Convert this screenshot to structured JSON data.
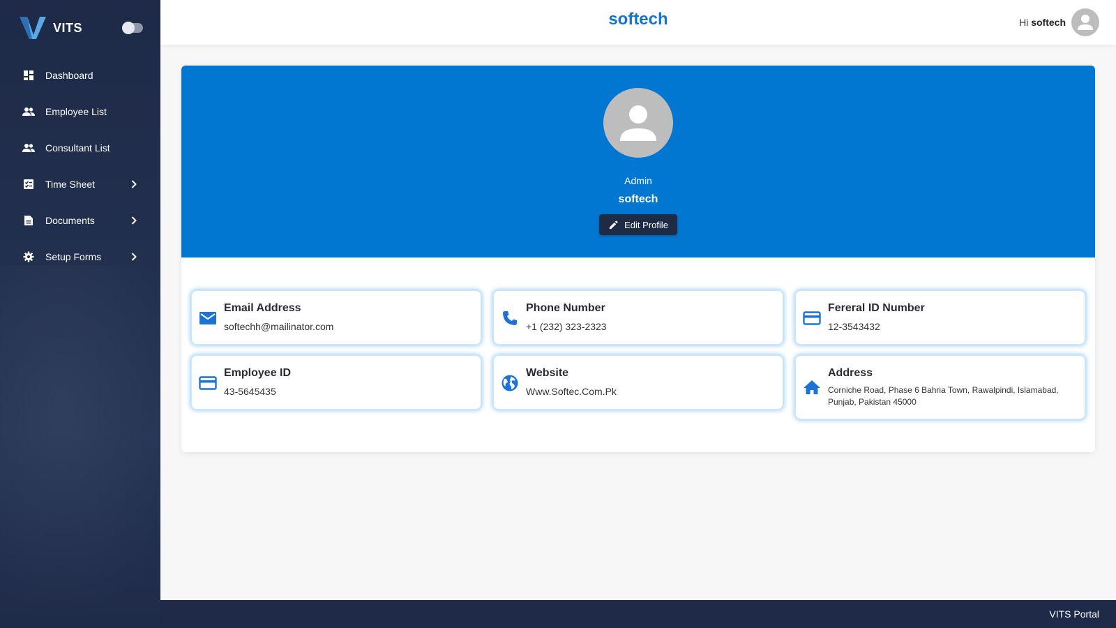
{
  "sidebar": {
    "brand": "VITS",
    "items": [
      {
        "label": "Dashboard",
        "icon": "dashboard-icon"
      },
      {
        "label": "Employee List",
        "icon": "people-icon"
      },
      {
        "label": "Consultant List",
        "icon": "people-icon"
      },
      {
        "label": "Time Sheet",
        "icon": "timesheet-icon",
        "has_submenu": true
      },
      {
        "label": "Documents",
        "icon": "document-icon",
        "has_submenu": true
      },
      {
        "label": "Setup Forms",
        "icon": "gear-icon",
        "has_submenu": true
      }
    ]
  },
  "header": {
    "title": "softech",
    "greeting_prefix": "Hi",
    "user_name": "softech"
  },
  "profile": {
    "role": "Admin",
    "name": "softech",
    "edit_label": "Edit Profile"
  },
  "info_cards": [
    {
      "title": "Email Address",
      "value": "softechh@mailinator.com",
      "icon": "mail-icon"
    },
    {
      "title": "Phone Number",
      "value": "+1 (232) 323-2323",
      "icon": "phone-icon"
    },
    {
      "title": "Fereral ID Number",
      "value": "12-3543432",
      "icon": "id-card-icon"
    },
    {
      "title": "Employee ID",
      "value": "43-5645435",
      "icon": "id-card-icon"
    },
    {
      "title": "Website",
      "value": "Www.Softec.Com.Pk",
      "icon": "globe-icon"
    },
    {
      "title": "Address",
      "value": "Corniche Road, Phase 6 Bahria Town, Rawalpindi, Islamabad, Punjab, Pakistan 45000",
      "icon": "home-icon"
    }
  ],
  "footer": {
    "text": "VITS Portal"
  },
  "colors": {
    "sidebar_bg": "#1e2a47",
    "accent": "#0177d1",
    "title_blue": "#1474c9",
    "icon_blue": "#1a73d6"
  }
}
